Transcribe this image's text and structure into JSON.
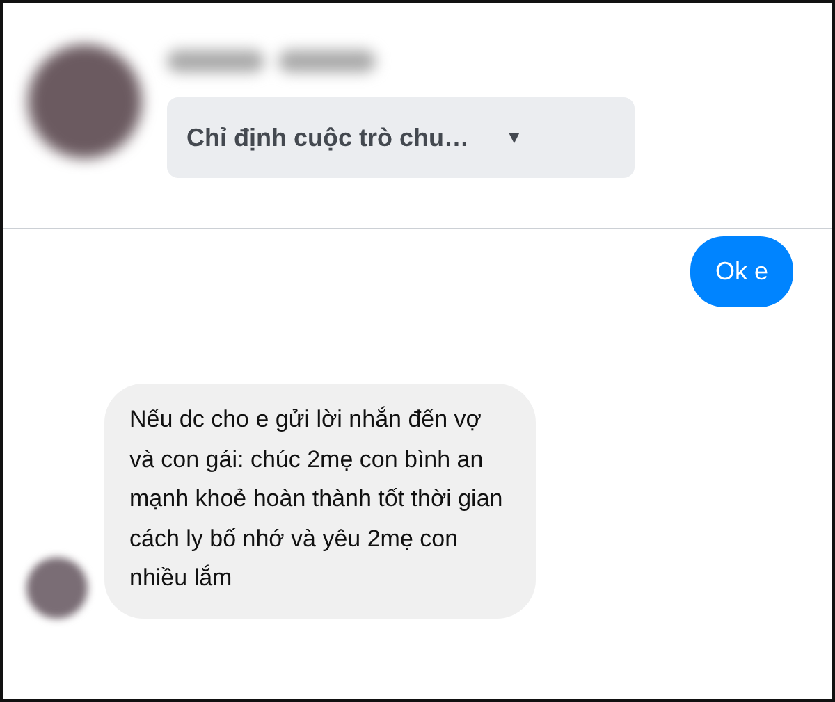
{
  "header": {
    "dropdown": {
      "label": "Chỉ định cuộc trò chu…",
      "caret": "▼"
    }
  },
  "messages": [
    {
      "kind": "sent",
      "text": "Ok e"
    },
    {
      "kind": "received",
      "text": "Nếu dc cho e gửi lời nhắn đến vợ và con gái: chúc 2mẹ con bình an mạnh khoẻ hoàn thành tốt thời gian cách ly bố nhớ và yêu 2mẹ con nhiều lắm"
    }
  ]
}
